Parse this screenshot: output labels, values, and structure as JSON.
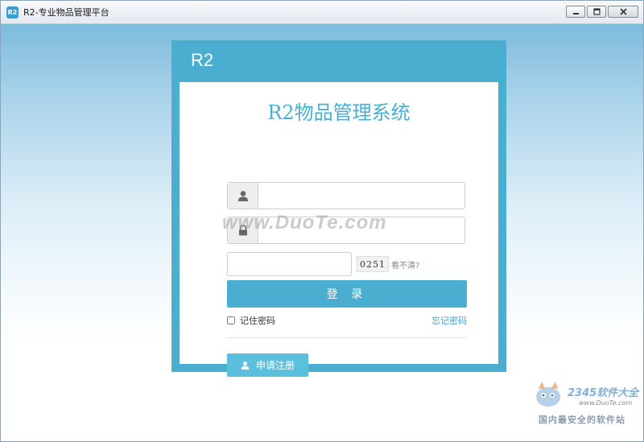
{
  "window": {
    "title": "R2-专业物品管理平台",
    "app_icon_text": "R2",
    "controls": {
      "minimize_icon": "minimize-icon",
      "maximize_icon": "maximize-icon",
      "close_icon": "close-icon"
    }
  },
  "login": {
    "brand": "R2",
    "system_title": "R2物品管理系统",
    "username": {
      "value": "",
      "placeholder": "",
      "icon": "user-icon"
    },
    "password": {
      "value": "",
      "placeholder": "",
      "icon": "lock-icon"
    },
    "captcha": {
      "value": "",
      "image_text": "0251",
      "refresh_text": "看不清?"
    },
    "login_button": "登 录",
    "remember_label": "记住密码",
    "forgot_label": "忘记密码",
    "register_button": "申请注册"
  },
  "watermark": {
    "text": "www.DuoTe.com",
    "badge_name": "2345软件大全",
    "badge_url": "www.DuoTe.com",
    "badge_slogan": "国内最安全的软件站"
  },
  "colors": {
    "accent": "#4aaed0",
    "register": "#5bc0de",
    "link": "#4aa0c8"
  }
}
